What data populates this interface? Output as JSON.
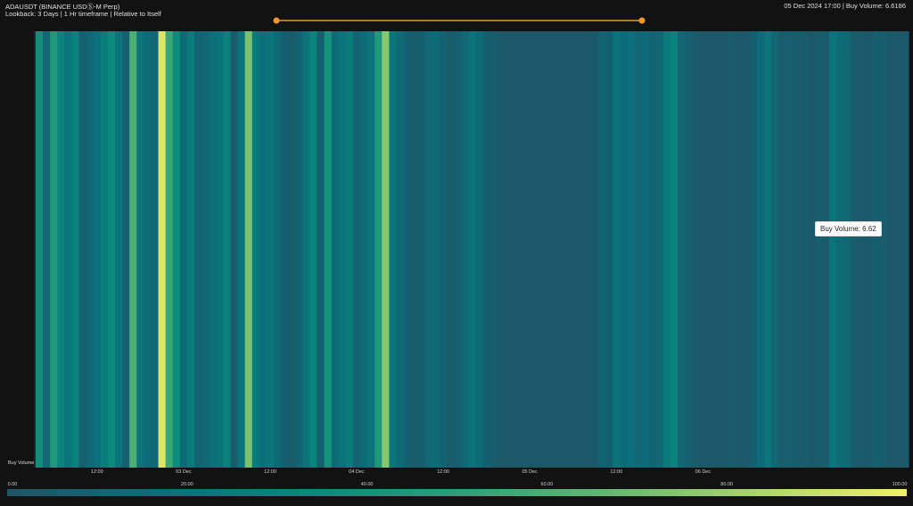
{
  "header": {
    "title": "ADAUSDT (BINANCE USDⓈ-M Perp)",
    "subtitle": "Lookback: 3 Days | 1 Hr timeframe | Relative to Itself",
    "readout": "05 Dec 2024 17:00 | Buy Volume: 6.6186"
  },
  "tooltip": {
    "label": "Buy Volume:",
    "value": "6.62"
  },
  "colors": {
    "background": "#121212",
    "slider": "#f0962a",
    "scale": [
      "#1f5466",
      "#0b6e7a",
      "#09887c",
      "#2a9f79",
      "#62b871",
      "#aad56c",
      "#f2ee6a"
    ]
  },
  "chart_data": {
    "type": "heatmap",
    "title": "ADAUSDT (BINANCE USDⓈ-M Perp)",
    "xlabel": "",
    "ylabel": "Buy Volume",
    "rows": [
      "Buy Volume"
    ],
    "x_tick_labels": [
      "12:00",
      "03 Dec",
      "12:00",
      "04 Dec",
      "12:00",
      "05 Dec",
      "12:00",
      "06 Dec"
    ],
    "x_ticks_hour_index": [
      8,
      20,
      32,
      44,
      56,
      68,
      80,
      92
    ],
    "values": [
      38,
      12,
      45,
      30,
      22,
      30,
      8,
      12,
      18,
      25,
      35,
      20,
      8,
      60,
      20,
      15,
      12,
      95,
      55,
      35,
      15,
      25,
      10,
      12,
      18,
      20,
      28,
      5,
      20,
      72,
      25,
      18,
      22,
      14,
      8,
      5,
      10,
      20,
      30,
      8,
      40,
      15,
      20,
      25,
      10,
      15,
      20,
      45,
      75,
      22,
      15,
      8,
      5,
      8,
      12,
      15,
      10,
      5,
      8,
      12,
      20,
      15,
      8,
      5,
      3,
      2,
      3,
      3,
      3,
      3,
      3,
      3,
      3,
      3,
      3,
      3,
      3,
      3,
      10,
      8,
      20,
      15,
      18,
      12,
      15,
      10,
      12,
      25,
      30,
      12,
      8,
      5,
      3,
      3,
      3,
      3,
      5,
      3,
      3,
      8,
      15,
      22,
      12,
      5,
      8,
      6,
      5,
      3,
      5,
      5,
      20,
      15,
      12,
      5,
      4,
      3,
      6.62,
      5,
      3,
      3,
      3
    ],
    "colorbar": {
      "min": 0,
      "max": 100,
      "ticks": [
        "0.00",
        "20.00",
        "40.00",
        "60.00",
        "80.00",
        "100.00"
      ]
    },
    "selected": {
      "time": "05 Dec 2024 17:00",
      "value": 6.6186
    },
    "legend": "bottom"
  }
}
